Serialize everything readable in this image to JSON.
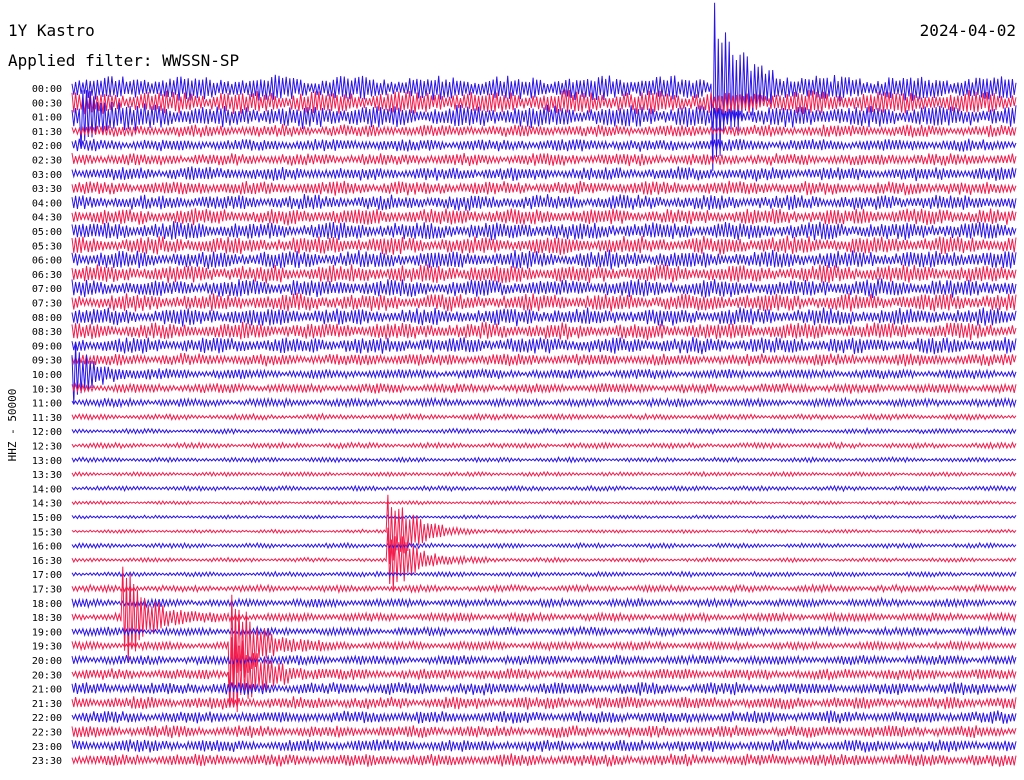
{
  "header": {
    "station": "1Y Kastro",
    "date": "2024-04-02",
    "filter_line": "Applied filter: WWSSN-SP"
  },
  "axis": {
    "side_label": "HHZ - 50000"
  },
  "colors": {
    "trace_a": "#2a14e6",
    "trace_b": "#f21c4c",
    "text": "#000000",
    "background": "#ffffff"
  },
  "chart_data": {
    "type": "line",
    "title": "1Y Kastro",
    "subtitle": "Applied filter: WWSSN-SP",
    "ylabel": "HHZ - 50000",
    "xlabel": "",
    "grid": false,
    "legend": "none",
    "row_interval_minutes": 30,
    "categories": [
      "00:00",
      "00:30",
      "01:00",
      "01:30",
      "02:00",
      "02:30",
      "03:00",
      "03:30",
      "04:00",
      "04:30",
      "05:00",
      "05:30",
      "06:00",
      "06:30",
      "07:00",
      "07:30",
      "08:00",
      "08:30",
      "09:00",
      "09:30",
      "10:00",
      "10:30",
      "11:00",
      "11:30",
      "12:00",
      "12:30",
      "13:00",
      "13:30",
      "14:00",
      "14:30",
      "15:00",
      "15:30",
      "16:00",
      "16:30",
      "17:00",
      "17:30",
      "18:00",
      "18:30",
      "19:00",
      "19:30",
      "20:00",
      "20:30",
      "21:00",
      "21:30",
      "22:00",
      "22:30",
      "23:00",
      "23:30"
    ],
    "row_amplitude": [
      1.8,
      1.7,
      1.6,
      0.9,
      0.9,
      0.9,
      1.0,
      1.0,
      1.1,
      1.2,
      1.3,
      1.3,
      1.3,
      1.3,
      1.3,
      1.3,
      1.3,
      1.2,
      1.2,
      0.9,
      0.7,
      0.7,
      0.6,
      0.4,
      0.35,
      0.4,
      0.35,
      0.3,
      0.35,
      0.25,
      0.25,
      0.25,
      0.35,
      0.3,
      0.35,
      0.5,
      0.6,
      0.6,
      0.6,
      0.6,
      0.7,
      0.8,
      0.9,
      0.9,
      0.9,
      0.9,
      0.9,
      0.9
    ],
    "events": [
      {
        "row": 0,
        "x_frac": 0.682,
        "peak": 6.0
      },
      {
        "row": 2,
        "x_frac": 0.012,
        "peak": 1.6
      },
      {
        "row": 20,
        "x_frac": 0.0,
        "peak": 2.0
      },
      {
        "row": 31,
        "x_frac": 0.337,
        "peak": 3.0
      },
      {
        "row": 33,
        "x_frac": 0.338,
        "peak": 2.5
      },
      {
        "row": 37,
        "x_frac": 0.057,
        "peak": 3.5
      },
      {
        "row": 39,
        "x_frac": 0.17,
        "peak": 4.0
      },
      {
        "row": 41,
        "x_frac": 0.17,
        "peak": 3.5
      }
    ]
  }
}
